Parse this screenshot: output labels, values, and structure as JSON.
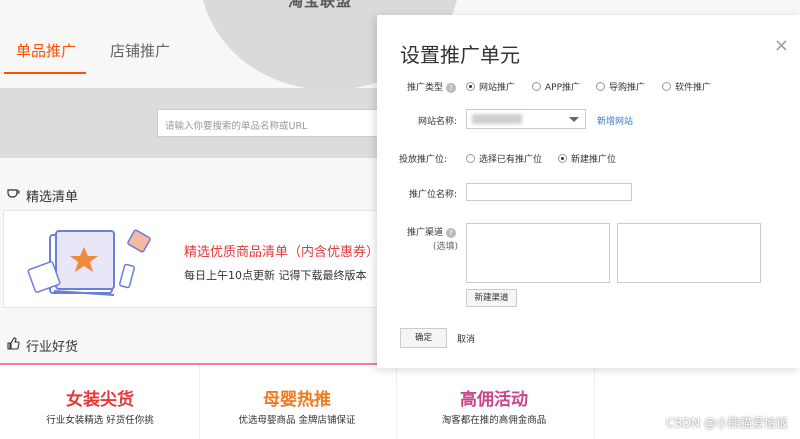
{
  "page": {
    "logo_title": "淘宝联盟",
    "tabs": [
      {
        "label": "单品推广"
      },
      {
        "label": "店铺推广"
      }
    ],
    "search": {
      "placeholder": "请输入你要搜索的单品名称或URL"
    },
    "selected_list": {
      "heading": "精选清单",
      "title": "精选优质商品清单（内含优惠券）",
      "subtitle": "每日上午10点更新 记得下载最终版本"
    },
    "industry": {
      "heading": "行业好货",
      "items": [
        {
          "title": "女装尖货",
          "subtitle": "行业女装精选 好货任你挑",
          "color": "#e4393c"
        },
        {
          "title": "母婴热推",
          "subtitle": "优选母婴商品 金牌店铺保证",
          "color": "#f07b1e"
        },
        {
          "title": "高佣活动",
          "subtitle": "淘客都在推的高佣金商品",
          "color": "#c9458d"
        }
      ]
    },
    "watermark": "CSDN @小熊猫爱恰饭"
  },
  "modal": {
    "title": "设置推广单元",
    "close": "×",
    "promo_type": {
      "label": "推广类型",
      "options": [
        {
          "label": "网站推广",
          "selected": true
        },
        {
          "label": "APP推广",
          "selected": false
        },
        {
          "label": "导购推广",
          "selected": false
        },
        {
          "label": "软件推广",
          "selected": false
        }
      ]
    },
    "site_name": {
      "label": "网站名称:",
      "new_link": "新增网站"
    },
    "slot": {
      "label": "投放推广位:",
      "options": [
        {
          "label": "选择已有推广位",
          "selected": false
        },
        {
          "label": "新建推广位",
          "selected": true
        }
      ]
    },
    "slot_name": {
      "label": "推广位名称:"
    },
    "channel": {
      "label": "推广渠道",
      "hint": "(选填)",
      "new_button": "新建渠道"
    },
    "confirm": "确定",
    "cancel": "取消",
    "help_icon": "?"
  },
  "colors": {
    "accent": "#ff5000",
    "link": "#3a78c3",
    "red": "#e4393c"
  }
}
